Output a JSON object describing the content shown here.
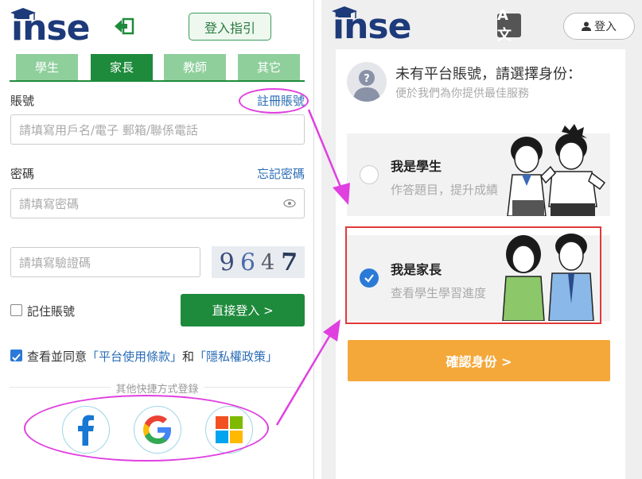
{
  "left": {
    "logo": "inse",
    "guide_button": "登入指引",
    "tabs": [
      {
        "label": "學生",
        "active": false
      },
      {
        "label": "家長",
        "active": true
      },
      {
        "label": "教師",
        "active": false
      },
      {
        "label": "其它",
        "active": false
      }
    ],
    "account_label": "賬號",
    "register_link": "註冊賬號",
    "account_placeholder": "請填寫用戶名/電子 郵箱/聯係電話",
    "password_label": "密碼",
    "forgot_link": "忘記密碼",
    "password_placeholder": "請填寫密碼",
    "captcha_placeholder": "請填寫驗證碼",
    "captcha_digits": [
      "9",
      "6",
      "4",
      "7"
    ],
    "remember_label": "記住賬號",
    "remember_checked": false,
    "login_button": "直接登入 >",
    "agree_prefix": "查看並同意",
    "terms_link": "「平台使用條款」",
    "agree_and": "和",
    "privacy_link": "「隱私權政策」",
    "agree_checked": true,
    "other_login_label": "其他快捷方式登錄",
    "social": [
      {
        "icon": "facebook-icon"
      },
      {
        "icon": "google-icon"
      },
      {
        "icon": "windows-icon"
      }
    ]
  },
  "right": {
    "logo": "inse",
    "translate_icon": "A文",
    "signin_label": "登入",
    "title": "未有平台賬號，請選擇身份：",
    "subtitle": "便於我們為你提供最佳服務",
    "roles": [
      {
        "name": "我是學生",
        "desc": "作答題目，提升成績",
        "selected": false
      },
      {
        "name": "我是家長",
        "desc": "查看學生學習進度",
        "selected": true
      }
    ],
    "confirm_button": "確認身份 >"
  },
  "colors": {
    "brand_green": "#1e8a3c",
    "tab_inactive": "#8fcf9c",
    "link_blue": "#2a6db5",
    "annotation_magenta": "#e040e0",
    "confirm_orange": "#f4a83a",
    "highlight_red": "#e03a3a"
  }
}
